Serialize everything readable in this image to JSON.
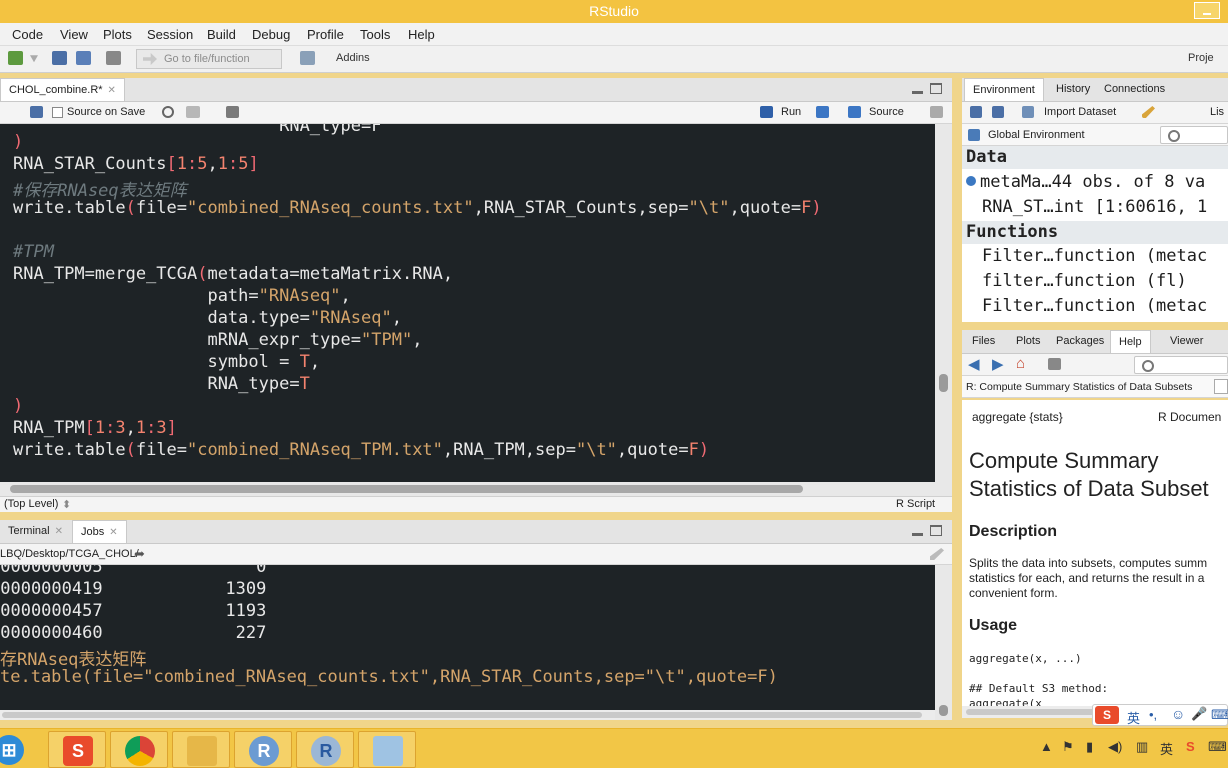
{
  "window": {
    "title": "RStudio"
  },
  "menu": [
    "Code",
    "View",
    "Plots",
    "Session",
    "Build",
    "Debug",
    "Profile",
    "Tools",
    "Help"
  ],
  "toolbar": {
    "goto_placeholder": "Go to file/function",
    "addins_label": "Addins",
    "project_label": "Proje"
  },
  "editor": {
    "tab_label": "CHOL_combine.R*",
    "source_on_save": "Source on Save",
    "run_label": "Run",
    "source_label": "Source",
    "scope_label": "(Top Level)",
    "filetype_label": "R Script",
    "lines": [
      {
        "parts": [
          {
            "t": "                          RNA_type=F",
            "c": "txt"
          }
        ]
      },
      {
        "parts": [
          {
            "t": ")",
            "c": "op"
          }
        ]
      },
      {
        "parts": [
          {
            "t": "RNA_STAR_Counts",
            "c": "txt"
          },
          {
            "t": "[",
            "c": "op"
          },
          {
            "t": "1",
            "c": "num"
          },
          {
            "t": ":",
            "c": "op"
          },
          {
            "t": "5",
            "c": "num"
          },
          {
            "t": ",",
            "c": "txt"
          },
          {
            "t": "1",
            "c": "num"
          },
          {
            "t": ":",
            "c": "op"
          },
          {
            "t": "5",
            "c": "num"
          },
          {
            "t": "]",
            "c": "op"
          }
        ]
      },
      {
        "parts": [
          {
            "t": "#保存RNAseq表达矩阵",
            "c": "cmt"
          }
        ]
      },
      {
        "parts": [
          {
            "t": "write.table",
            "c": "txt"
          },
          {
            "t": "(",
            "c": "op"
          },
          {
            "t": "file=",
            "c": "txt"
          },
          {
            "t": "\"combined_RNAseq_counts.txt\"",
            "c": "str"
          },
          {
            "t": ",RNA_STAR_Counts,sep=",
            "c": "txt"
          },
          {
            "t": "\"\\t\"",
            "c": "str"
          },
          {
            "t": ",quote=",
            "c": "txt"
          },
          {
            "t": "F",
            "c": "num"
          },
          {
            "t": ")",
            "c": "op"
          }
        ]
      },
      {
        "parts": [
          {
            "t": "",
            "c": "txt"
          }
        ]
      },
      {
        "parts": [
          {
            "t": "#TPM",
            "c": "cmt"
          }
        ]
      },
      {
        "parts": [
          {
            "t": "RNA_TPM=merge_TCGA",
            "c": "txt"
          },
          {
            "t": "(",
            "c": "op"
          },
          {
            "t": "metadata=metaMatrix.RNA,",
            "c": "txt"
          }
        ]
      },
      {
        "parts": [
          {
            "t": "                   path=",
            "c": "txt"
          },
          {
            "t": "\"RNAseq\"",
            "c": "str"
          },
          {
            "t": ",",
            "c": "txt"
          }
        ]
      },
      {
        "parts": [
          {
            "t": "                   data.type=",
            "c": "txt"
          },
          {
            "t": "\"RNAseq\"",
            "c": "str"
          },
          {
            "t": ",",
            "c": "txt"
          }
        ]
      },
      {
        "parts": [
          {
            "t": "                   mRNA_expr_type=",
            "c": "txt"
          },
          {
            "t": "\"TPM\"",
            "c": "str"
          },
          {
            "t": ",",
            "c": "txt"
          }
        ]
      },
      {
        "parts": [
          {
            "t": "                   symbol = ",
            "c": "txt"
          },
          {
            "t": "T",
            "c": "num"
          },
          {
            "t": ",",
            "c": "txt"
          }
        ]
      },
      {
        "parts": [
          {
            "t": "                   RNA_type=",
            "c": "txt"
          },
          {
            "t": "T",
            "c": "num"
          }
        ]
      },
      {
        "parts": [
          {
            "t": ")",
            "c": "op"
          }
        ]
      },
      {
        "parts": [
          {
            "t": "RNA_TPM",
            "c": "txt"
          },
          {
            "t": "[",
            "c": "op"
          },
          {
            "t": "1",
            "c": "num"
          },
          {
            "t": ":",
            "c": "op"
          },
          {
            "t": "3",
            "c": "num"
          },
          {
            "t": ",",
            "c": "txt"
          },
          {
            "t": "1",
            "c": "num"
          },
          {
            "t": ":",
            "c": "op"
          },
          {
            "t": "3",
            "c": "num"
          },
          {
            "t": "]",
            "c": "op"
          }
        ]
      },
      {
        "parts": [
          {
            "t": "write.table",
            "c": "txt"
          },
          {
            "t": "(",
            "c": "op"
          },
          {
            "t": "file=",
            "c": "txt"
          },
          {
            "t": "\"combined_RNAseq_TPM.txt\"",
            "c": "str"
          },
          {
            "t": ",RNA_TPM,sep=",
            "c": "txt"
          },
          {
            "t": "\"\\t\"",
            "c": "str"
          },
          {
            "t": ",quote=",
            "c": "txt"
          },
          {
            "t": "F",
            "c": "num"
          },
          {
            "t": ")",
            "c": "op"
          }
        ]
      }
    ]
  },
  "console": {
    "tabs": [
      "Terminal",
      "Jobs"
    ],
    "path": "LBQ/Desktop/TCGA_CHOL/",
    "lines": [
      {
        "t": "00000000005               0",
        "c": "txt"
      },
      {
        "t": "00000000419            1309",
        "c": "txt"
      },
      {
        "t": "00000000457            1193",
        "c": "txt"
      },
      {
        "t": "00000000460             227",
        "c": "txt"
      },
      {
        "t": "存RNAseq表达矩阵",
        "c": "cn"
      },
      {
        "t": "te.table(file=\"combined_RNAseq_counts.txt\",RNA_STAR_Counts,sep=\"\\t\",quote=F)",
        "c": "cn"
      }
    ]
  },
  "environment": {
    "tabs": [
      "Environment",
      "History",
      "Connections"
    ],
    "import_label": "Import Dataset",
    "list_label": "Lis",
    "scope_label": "Global Environment",
    "data_header": "Data",
    "functions_header": "Functions",
    "data_rows": [
      {
        "name": "metaMa…",
        "value": "44 obs. of 8 va"
      },
      {
        "name": "RNA_ST…",
        "value": "int [1:60616, 1"
      }
    ],
    "function_rows": [
      {
        "name": "Filter…",
        "value": "function (metac"
      },
      {
        "name": "filter…",
        "value": "function (fl)"
      },
      {
        "name": "Filter…",
        "value": "function (metac"
      }
    ]
  },
  "help": {
    "tabs": [
      "Files",
      "Plots",
      "Packages",
      "Help",
      "Viewer"
    ],
    "topic_select": "R: Compute Summary Statistics of Data Subsets",
    "pkg_label": "aggregate {stats}",
    "doc_label": "R Documen",
    "title_line1": "Compute Summary",
    "title_line2": "Statistics of Data Subset",
    "description_heading": "Description",
    "description_text": "Splits the data into subsets, computes summ statistics for each, and returns the result in a convenient form.",
    "usage_heading": "Usage",
    "usage_line1": "aggregate(x, ...)",
    "usage_line2": "## Default S3 method:",
    "usage_line3": "aggregate(x"
  },
  "taskbar": {
    "apps": [
      "S",
      "",
      "",
      "R",
      "R",
      ""
    ],
    "tray_lang": "英",
    "ime": "英"
  },
  "colors": {
    "editor_bg": "#1e2326",
    "string": "#d4a46a",
    "number": "#f4836f",
    "comment": "#6e7a7f",
    "taskbar": "#f2c646"
  }
}
